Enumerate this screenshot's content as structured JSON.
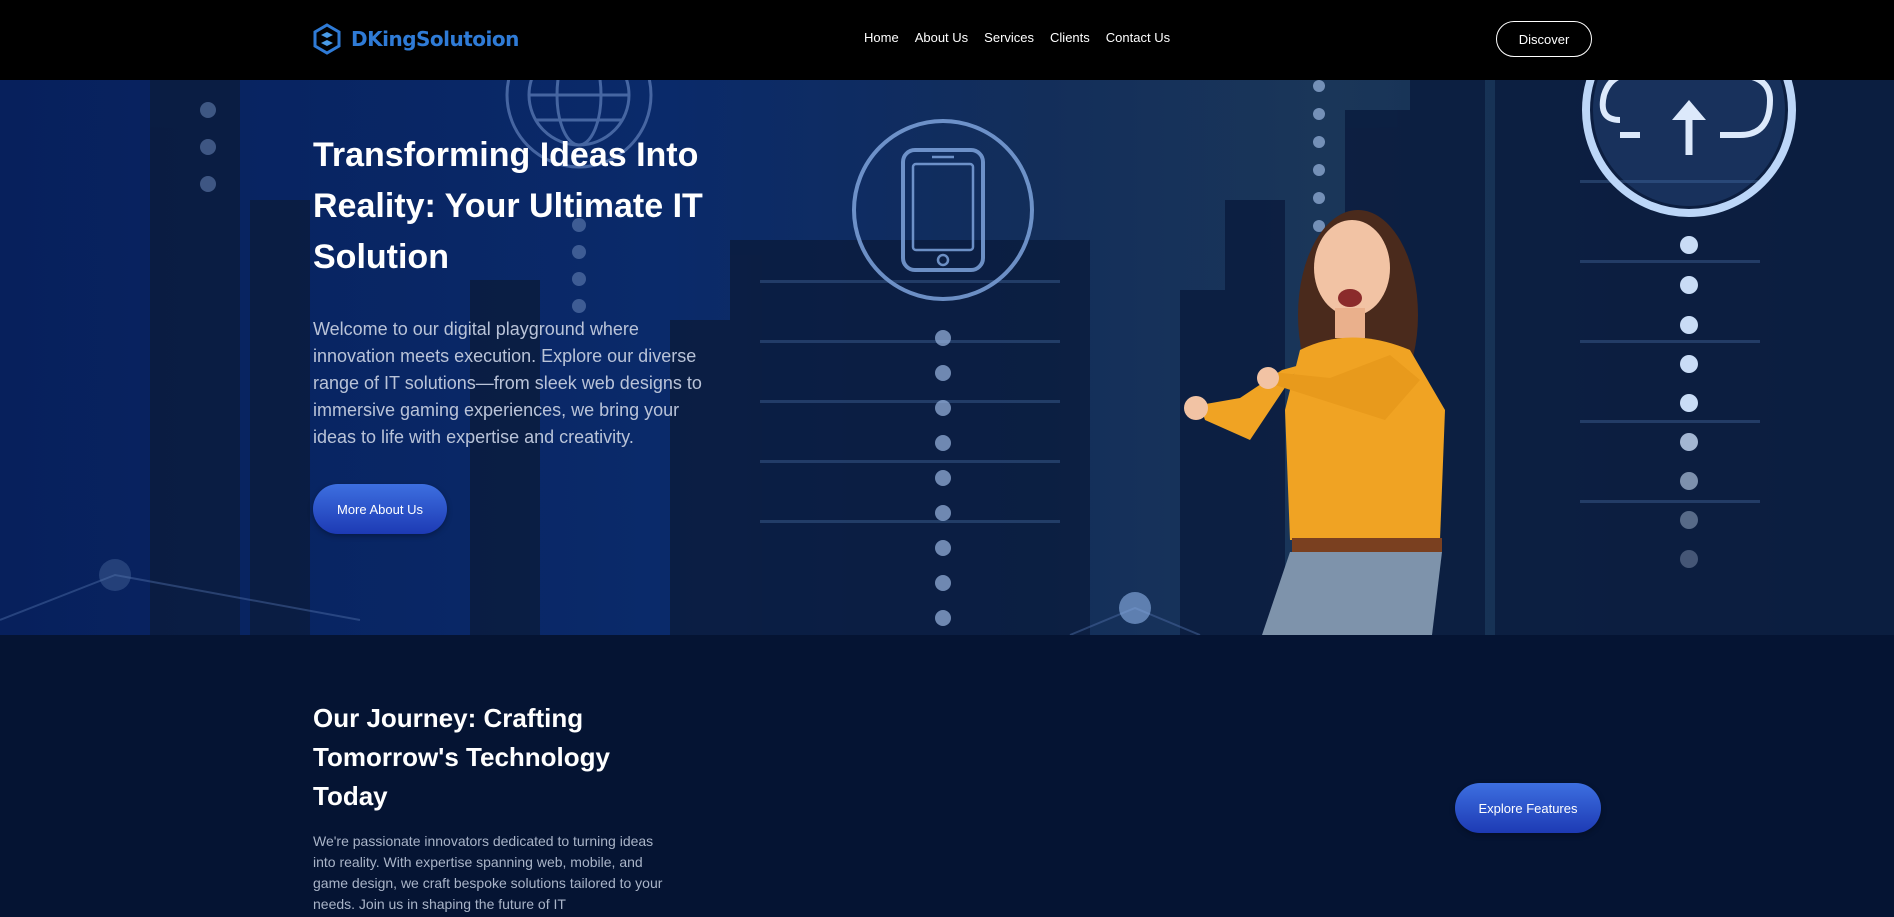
{
  "brand": {
    "logo_icon": "hexagon-swirl-icon",
    "name": "DKingSolutoion",
    "color": "#2f7bd6"
  },
  "nav": {
    "items": [
      "Home",
      "About Us",
      "Services",
      "Clients",
      "Contact Us"
    ],
    "cta_label": "Discover"
  },
  "hero": {
    "title": "Transforming Ideas Into Reality: Your Ultimate IT Solution",
    "text": "Welcome to our digital playground where innovation meets execution. Explore our diverse range of IT solutions—from sleek web designs to immersive gaming experiences, we bring your ideas to life with expertise and creativity.",
    "button_label": "More About Us",
    "icons": [
      "globe-icon",
      "smartphone-icon",
      "cloud-upload-icon"
    ],
    "image": "woman-pointing-photo"
  },
  "journey": {
    "title": "Our Journey: Crafting Tomorrow's Technology Today",
    "text": "We're passionate innovators dedicated to turning ideas into reality. With expertise spanning web, mobile, and game design, we craft bespoke solutions tailored to your needs. Join us in shaping the future of IT",
    "button_label": "Explore Features"
  },
  "colors": {
    "accent": "#2f5fd6",
    "page_bg": "#051433",
    "nav_bg": "#000000"
  }
}
